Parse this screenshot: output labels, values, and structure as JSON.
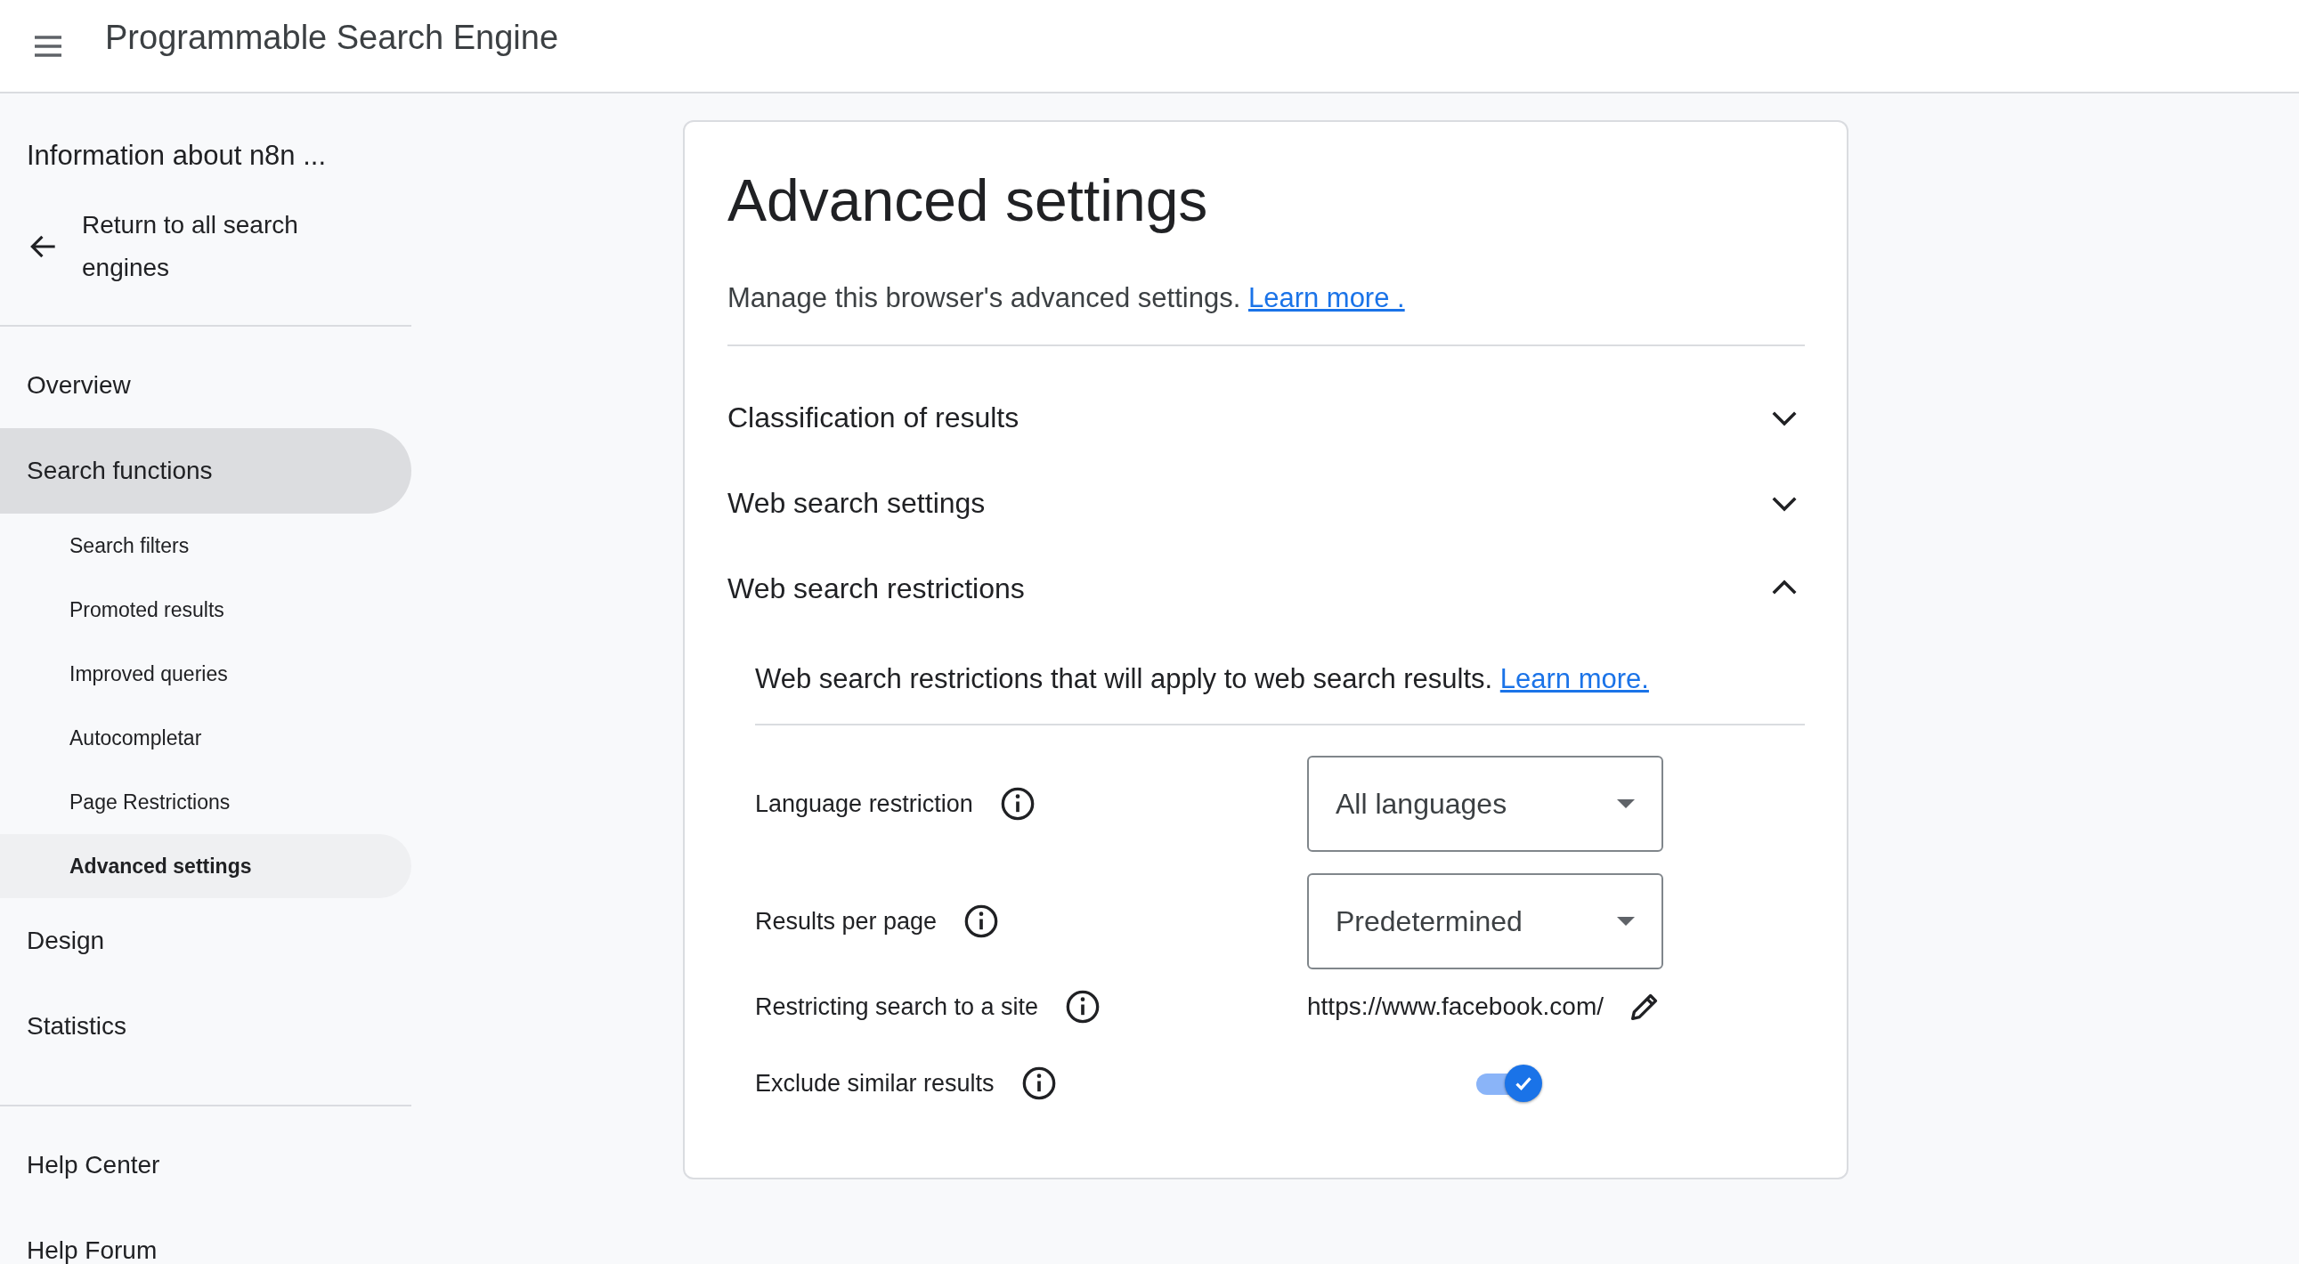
{
  "header": {
    "title": "Programmable Search Engine"
  },
  "sidebar": {
    "engine_name": "Information about n8n ...",
    "back_link": "Return to all search engines",
    "nav": [
      {
        "label": "Overview",
        "selected": false
      },
      {
        "label": "Search functions",
        "selected": true,
        "children": [
          {
            "label": "Search filters",
            "selected": false
          },
          {
            "label": "Promoted results",
            "selected": false
          },
          {
            "label": "Improved queries",
            "selected": false
          },
          {
            "label": "Autocompletar",
            "selected": false
          },
          {
            "label": "Page Restrictions",
            "selected": false
          },
          {
            "label": "Advanced settings",
            "selected": true
          }
        ]
      },
      {
        "label": "Design",
        "selected": false
      },
      {
        "label": "Statistics",
        "selected": false
      }
    ],
    "help": [
      {
        "label": "Help Center"
      },
      {
        "label": "Help Forum"
      }
    ]
  },
  "main": {
    "title": "Advanced settings",
    "description": {
      "text": "Manage this browser's advanced settings.",
      "link": "Learn more ."
    },
    "sections": [
      {
        "title": "Classification of results",
        "expanded": false
      },
      {
        "title": "Web search settings",
        "expanded": false
      },
      {
        "title": "Web search restrictions",
        "expanded": true,
        "description": {
          "text": "Web search restrictions that will apply to web search results.",
          "link": "Learn more."
        },
        "settings": [
          {
            "kind": "select",
            "label": "Language restriction",
            "value": "All languages"
          },
          {
            "kind": "select",
            "label": "Results per page",
            "value": "Predetermined"
          },
          {
            "kind": "url",
            "label": "Restricting search to a site",
            "value": "https://www.facebook.com/"
          },
          {
            "kind": "toggle",
            "label": "Exclude similar results",
            "on": true
          }
        ]
      }
    ]
  }
}
